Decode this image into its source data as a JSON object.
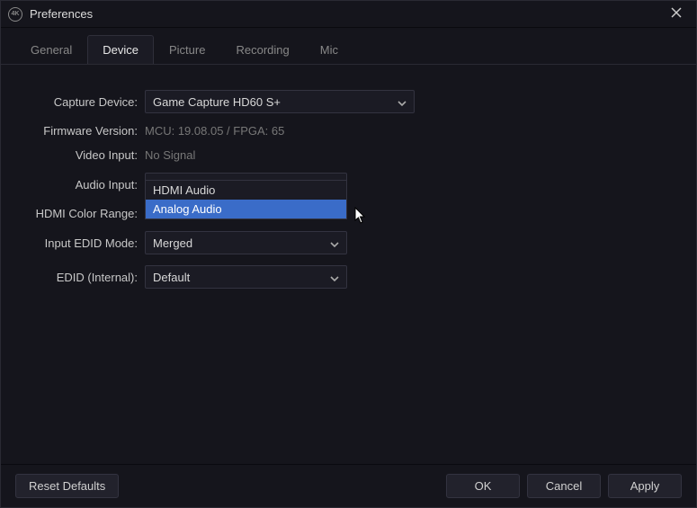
{
  "window": {
    "title": "Preferences",
    "icon_label": "4K"
  },
  "tabs": [
    {
      "label": "General"
    },
    {
      "label": "Device"
    },
    {
      "label": "Picture"
    },
    {
      "label": "Recording"
    },
    {
      "label": "Mic"
    }
  ],
  "active_tab": 1,
  "form": {
    "capture_device": {
      "label": "Capture Device:",
      "value": "Game Capture HD60 S+"
    },
    "firmware_version": {
      "label": "Firmware Version:",
      "value": "MCU: 19.08.05 / FPGA: 65"
    },
    "video_input": {
      "label": "Video Input:",
      "value": "No Signal"
    },
    "audio_input": {
      "label": "Audio Input:",
      "value": "Analog Audio"
    },
    "audio_input_dropdown": {
      "options": [
        "HDMI Audio",
        "Analog Audio"
      ],
      "highlighted": 1
    },
    "hdmi_color_range": {
      "label": "HDMI Color Range:"
    },
    "input_edid_mode": {
      "label": "Input EDID Mode:",
      "value": "Merged"
    },
    "edid_internal": {
      "label": "EDID (Internal):",
      "value": "Default"
    }
  },
  "footer": {
    "reset": "Reset Defaults",
    "ok": "OK",
    "cancel": "Cancel",
    "apply": "Apply"
  }
}
